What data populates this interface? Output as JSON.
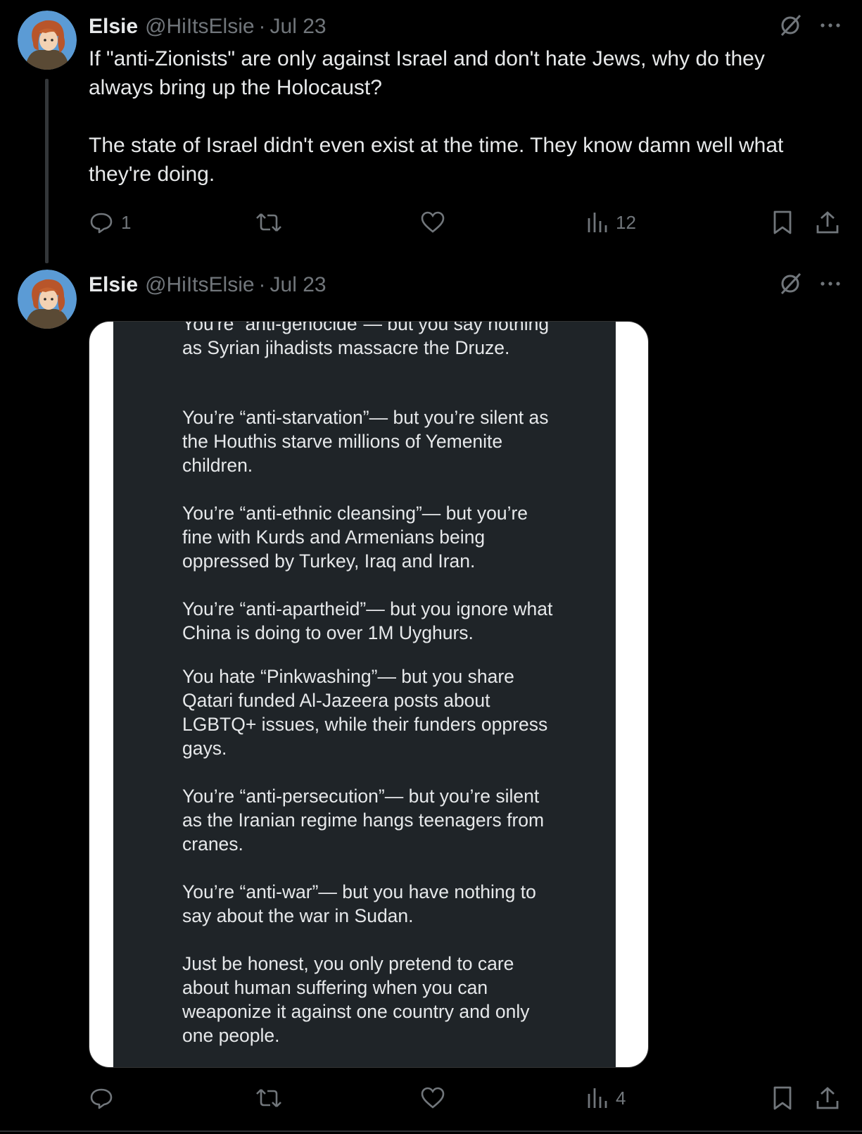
{
  "tweets": [
    {
      "name": "Elsie",
      "handle": "@HiItsElsie",
      "separator": "·",
      "date": "Jul 23",
      "text": [
        "If \"anti-Zionists\" are only against Israel and don't hate Jews, why do they always bring up the Holocaust?",
        "The state of Israel didn't even exist at the time. They know damn well what they're doing."
      ],
      "actions": {
        "replies": "1",
        "retweets": "",
        "likes": "",
        "views": "12"
      }
    },
    {
      "name": "Elsie",
      "handle": "@HiItsElsie",
      "separator": "·",
      "date": "Jul 23",
      "image_text": [
        "You're “anti-genocide”— but you say nothing as Syrian jihadists massacre the Druze.",
        "You’re “anti-starvation”— but you’re silent as the Houthis starve millions of Yemenite children.",
        "You’re “anti-ethnic cleansing”— but you’re fine with Kurds and Armenians being oppressed by Turkey, Iraq and Iran.",
        "You’re “anti-apartheid”— but you ignore what China is doing to over 1M Uyghurs.",
        "You hate “Pinkwashing”— but you share Qatari funded Al-Jazeera posts about LGBTQ+ issues, while their funders oppress gays.",
        "You’re “anti-persecution”— but you’re silent as the Iranian regime hangs teenagers from cranes.",
        "You’re “anti-war”— but you have nothing to say about the war in Sudan.",
        "Just be honest, you only pretend to care about human suffering when you can weaponize it against one country and only one people."
      ],
      "actions": {
        "replies": "",
        "retweets": "",
        "likes": "",
        "views": "4"
      }
    }
  ],
  "icons": {
    "grok": "grok-icon",
    "more": "more-icon",
    "reply": "reply-icon",
    "retweet": "retweet-icon",
    "like": "like-icon",
    "views": "views-icon",
    "bookmark": "bookmark-icon",
    "share": "share-icon"
  },
  "colors": {
    "background": "#000000",
    "primary_text": "#e7e9ea",
    "secondary_text": "#71767b",
    "thread_line": "#333639",
    "screenshot_bg": "#1f2428"
  }
}
